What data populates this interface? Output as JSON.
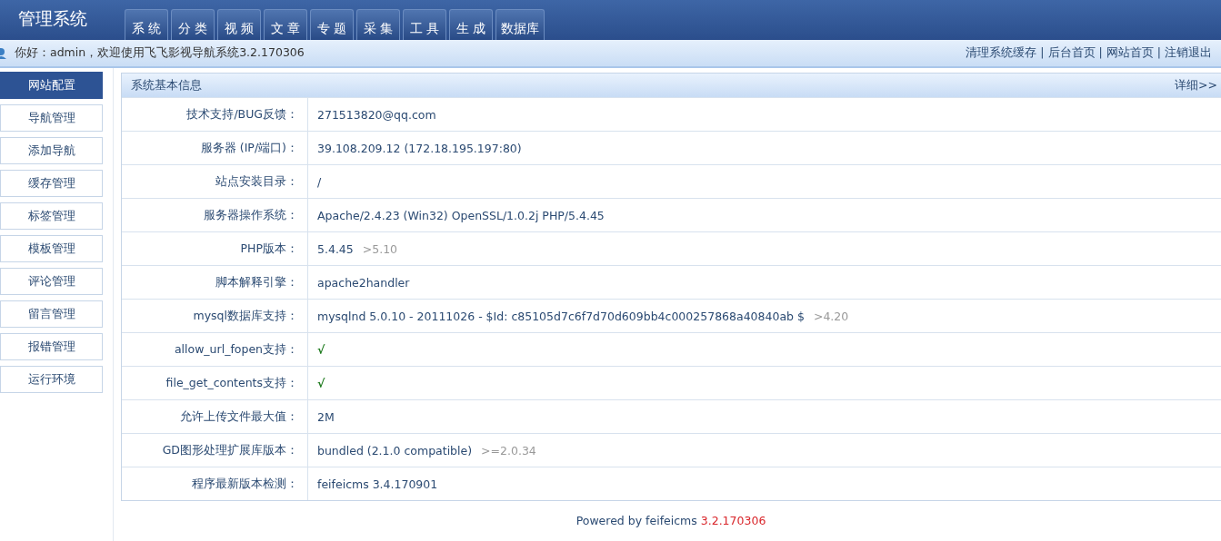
{
  "header": {
    "logo": "管理系统",
    "tabs": [
      {
        "label": "系 统",
        "selected": false
      },
      {
        "label": "分 类",
        "selected": false
      },
      {
        "label": "视 频",
        "selected": false
      },
      {
        "label": "文 章",
        "selected": false
      },
      {
        "label": "专 题",
        "selected": false
      },
      {
        "label": "采 集",
        "selected": false
      },
      {
        "label": "工 具",
        "selected": false
      },
      {
        "label": "生 成",
        "selected": false
      },
      {
        "label": "数据库",
        "selected": false
      }
    ]
  },
  "info_bar": {
    "greeting": "你好：admin，欢迎使用飞飞影视导航系统3.2.170306",
    "link_separator": "|",
    "links": [
      "清理系统缓存",
      "后台首页",
      "网站首页",
      "注销退出"
    ]
  },
  "sidebar": {
    "items": [
      {
        "label": "网站配置",
        "selected": true
      },
      {
        "label": "导航管理",
        "selected": false
      },
      {
        "label": "添加导航",
        "selected": false
      },
      {
        "label": "缓存管理",
        "selected": false
      },
      {
        "label": "标签管理",
        "selected": false
      },
      {
        "label": "模板管理",
        "selected": false
      },
      {
        "label": "评论管理",
        "selected": false
      },
      {
        "label": "留言管理",
        "selected": false
      },
      {
        "label": "报错管理",
        "selected": false
      },
      {
        "label": "运行环境",
        "selected": false
      }
    ]
  },
  "panel": {
    "title": "系统基本信息",
    "more_link": "详细>>",
    "rows": [
      {
        "label": "技术支持/BUG反馈：",
        "value": "271513820@qq.com",
        "kind": "text"
      },
      {
        "label": "服务器 (IP/端口)：",
        "value": "39.108.209.12 (172.18.195.197:80)",
        "kind": "text"
      },
      {
        "label": "站点安装目录：",
        "value": "/",
        "kind": "text"
      },
      {
        "label": "服务器操作系统：",
        "value": "Apache/2.4.23 (Win32) OpenSSL/1.0.2j PHP/5.4.45",
        "kind": "text"
      },
      {
        "label": "PHP版本：",
        "value": "5.4.45",
        "requirement": ">5.10",
        "kind": "text"
      },
      {
        "label": "脚本解释引擎：",
        "value": "apache2handler",
        "kind": "text"
      },
      {
        "label": "mysql数据库支持：",
        "value": "mysqlnd 5.0.10 - 20111026 - $Id: c85105d7c6f7d70d609bb4c000257868a40840ab $",
        "requirement": ">4.20",
        "kind": "text"
      },
      {
        "label": "allow_url_fopen支持：",
        "value": "√",
        "kind": "check"
      },
      {
        "label": "file_get_contents支持：",
        "value": "√",
        "kind": "check"
      },
      {
        "label": "允许上传文件最大值：",
        "value": "2M",
        "kind": "text"
      },
      {
        "label": "GD图形处理扩展库版本：",
        "value": "bundled (2.1.0 compatible)",
        "requirement": ">=2.0.34",
        "kind": "text"
      },
      {
        "label": "程序最新版本检测：",
        "value": "feifeicms 3.4.170901",
        "kind": "text"
      }
    ]
  },
  "footer": {
    "text": "Powered by feifeicms",
    "version": "3.2.170306"
  }
}
